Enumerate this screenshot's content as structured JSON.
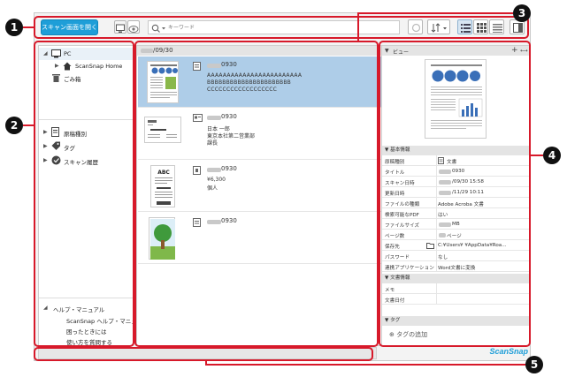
{
  "callouts": [
    "1",
    "2",
    "3",
    "4",
    "5"
  ],
  "toolbar": {
    "scan_button": "スキャン画面を開く",
    "search_placeholder": "キーワード"
  },
  "sidebar": {
    "pc_label": "PC",
    "home_label": "ScanSnap Home",
    "trash_label": "ごみ箱",
    "doc_type_label": "原稿種別",
    "tag_label": "タグ",
    "history_label": "スキャン履歴",
    "help_header": "ヘルプ・マニュアル",
    "help_items": [
      "ScanSnap ヘルプ・マニュアル",
      "困ったときには",
      "使い方を質問する"
    ]
  },
  "list": {
    "date_header": "/09/30",
    "rows": [
      {
        "title": "0930",
        "lines": [
          "AAAAAAAAAAAAAAAAAAAAAAAA",
          "BBBBBBBBBBBBBBBBBBBBBB",
          "CCCCCCCCCCCCCCCCCC"
        ]
      },
      {
        "title": "0930",
        "lines": [
          "日本 一郎",
          "東京本社第二営業部",
          "課長"
        ]
      },
      {
        "title": "0930",
        "lines": [
          "¥6,300",
          "個人"
        ]
      },
      {
        "title": "0930",
        "lines": []
      }
    ]
  },
  "preview": {
    "view_label": "ビュー",
    "basic_info_header": "基本情報",
    "props": [
      {
        "k": "原稿種別",
        "v": "文書"
      },
      {
        "k": "タイトル",
        "v": "0930"
      },
      {
        "k": "スキャン日時",
        "v": "/09/30 15:58"
      },
      {
        "k": "更新日時",
        "v": "/11/29 10:11"
      },
      {
        "k": "ファイルの種類",
        "v": "Adobe Acroba 文書"
      },
      {
        "k": "検索可能なPDF",
        "v": "はい"
      },
      {
        "k": "ファイルサイズ",
        "v": "MB"
      },
      {
        "k": "ページ数",
        "v": "ページ"
      },
      {
        "k": "保存先",
        "v": "C:¥Users¥           ¥AppData¥Roa..."
      },
      {
        "k": "パスワード",
        "v": "なし"
      },
      {
        "k": "連携アプリケーション",
        "v": "Word文書に変換"
      }
    ],
    "doc_info_header": "文書情報",
    "doc_props": [
      {
        "k": "メモ",
        "v": ""
      },
      {
        "k": "文書日付",
        "v": ""
      }
    ],
    "tag_header": "タグ",
    "add_tag_label": "タグの追加"
  },
  "brand": "ScanSnap",
  "colors": {
    "accent": "#1e9ed8",
    "callout_red": "#d7192a",
    "selection": "#aecde8"
  }
}
